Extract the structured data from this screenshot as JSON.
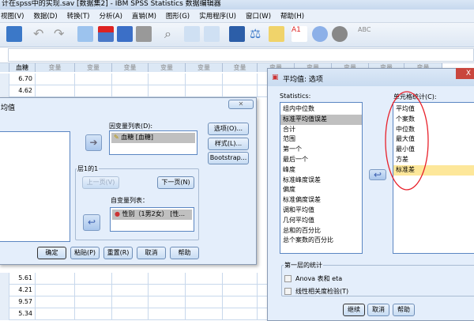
{
  "window": {
    "title": "计在spss中的实现.sav [数据集2] - IBM SPSS Statistics 数据编辑器"
  },
  "menu": [
    "视图(V)",
    "数据(D)",
    "转换(T)",
    "分析(A)",
    "直销(M)",
    "图形(G)",
    "实用程序(U)",
    "窗口(W)",
    "帮助(H)"
  ],
  "grid": {
    "columns": [
      "血糖",
      "变量",
      "变量",
      "变量",
      "变量",
      "变量",
      "变量",
      "变量",
      "变量",
      "变量",
      "变量",
      "变量"
    ],
    "top_values": [
      "6.70",
      "4.62"
    ],
    "bottom_values": [
      "5.61",
      "4.21",
      "9.57",
      "5.34"
    ]
  },
  "means_dialog": {
    "title": "均值",
    "dependent_label": "因变量列表(D):",
    "dependent_items": [
      "血糖 [血糖]"
    ],
    "layer_label": "层1的1",
    "prev": "上一页(V)",
    "next": "下一页(N)",
    "independent_label": "自变量列表：",
    "independent_items": [
      "性别（1男2女） [性..."
    ],
    "side_buttons": [
      "选项(O)...",
      "样式(L)...",
      "Bootstrap..."
    ],
    "bottom_buttons": [
      "确定",
      "粘贴(P)",
      "重置(R)",
      "取消",
      "帮助"
    ]
  },
  "options_dialog": {
    "title": "平均值: 选项",
    "close": "X",
    "statistics_label": "Statistics:",
    "statistics": [
      "组内中位数",
      "标准平均值误差",
      "合计",
      "范围",
      "第一个",
      "最后一个",
      "峰度",
      "标准峰度误差",
      "偏度",
      "标准偏度误差",
      "调和平均值",
      "几何平均值",
      "总和的百分比",
      "总个案数的百分比"
    ],
    "cell_label": "单元格统计(C):",
    "cell_stats": [
      "平均值",
      "个案数",
      "中位数",
      "最大值",
      "最小值",
      "方差",
      "标准差"
    ],
    "first_layer_label": "第一层的统计",
    "checkboxes": [
      {
        "label": "Anova 表和 eta",
        "checked": false
      },
      {
        "label": "线性相关度检验(T)",
        "checked": false
      }
    ],
    "buttons": [
      "继续",
      "取消",
      "帮助"
    ],
    "annotation_color": "#e8202a"
  }
}
